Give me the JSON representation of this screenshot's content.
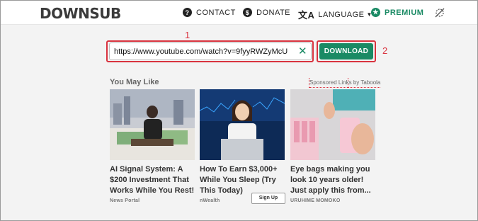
{
  "header": {
    "logo": "DOWNSUB",
    "nav": {
      "contact": "CONTACT",
      "donate": "DONATE",
      "language": "LANGUAGE",
      "premium": "PREMIUM"
    }
  },
  "search": {
    "url_value": "https://www.youtube.com/watch?v=9fyyRWZyMcU",
    "download_label": "DOWNLOAD",
    "marker_1": "1",
    "marker_2": "2"
  },
  "recommendations": {
    "heading": "You May Like",
    "sponsored": "Sponsored Links by Taboola",
    "cards": [
      {
        "title": "AI Signal System: A $200 Investment That Works While You Rest!",
        "source": "News Portal"
      },
      {
        "title": "How To Earn $3,000+ While You Sleep (Try This Today)",
        "source": "nWealth",
        "cta": "Sign Up"
      },
      {
        "title": "Eye bags making you look 10 years older! Just apply this from...",
        "source": "URUHIME MOMOKO"
      }
    ]
  },
  "colors": {
    "brand_green": "#1a8a64",
    "annotation_red": "#d9333f"
  },
  "icons": [
    "question-icon",
    "dollar-icon",
    "translate-icon",
    "star-icon",
    "theme-toggle-icon",
    "clear-icon"
  ]
}
